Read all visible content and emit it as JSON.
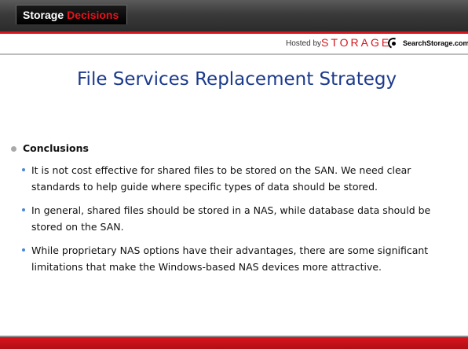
{
  "header": {
    "brand_primary": "Storage",
    "brand_accent": "Decisions",
    "hosted_by": "Hosted by",
    "storage_logo": "STORAGE",
    "searchstorage_logo": "SearchStorage.com"
  },
  "slide": {
    "title": "File Services Replacement Strategy",
    "heading": "Conclusions",
    "bullets": [
      "It is not cost effective for shared files to be stored on the SAN. We need clear standards to help guide where specific types of data should be stored.",
      "In general, shared files should be stored in a NAS, while database data should be stored on the SAN.",
      "While proprietary NAS options have their advantages, there are some significant limitations that make the Windows-based NAS devices more attractive."
    ]
  },
  "colors": {
    "accent_red": "#d9141c",
    "title_blue": "#1c3a8c",
    "bullet_blue": "#4a86d8",
    "bar_dark": "#2b2b2b"
  }
}
